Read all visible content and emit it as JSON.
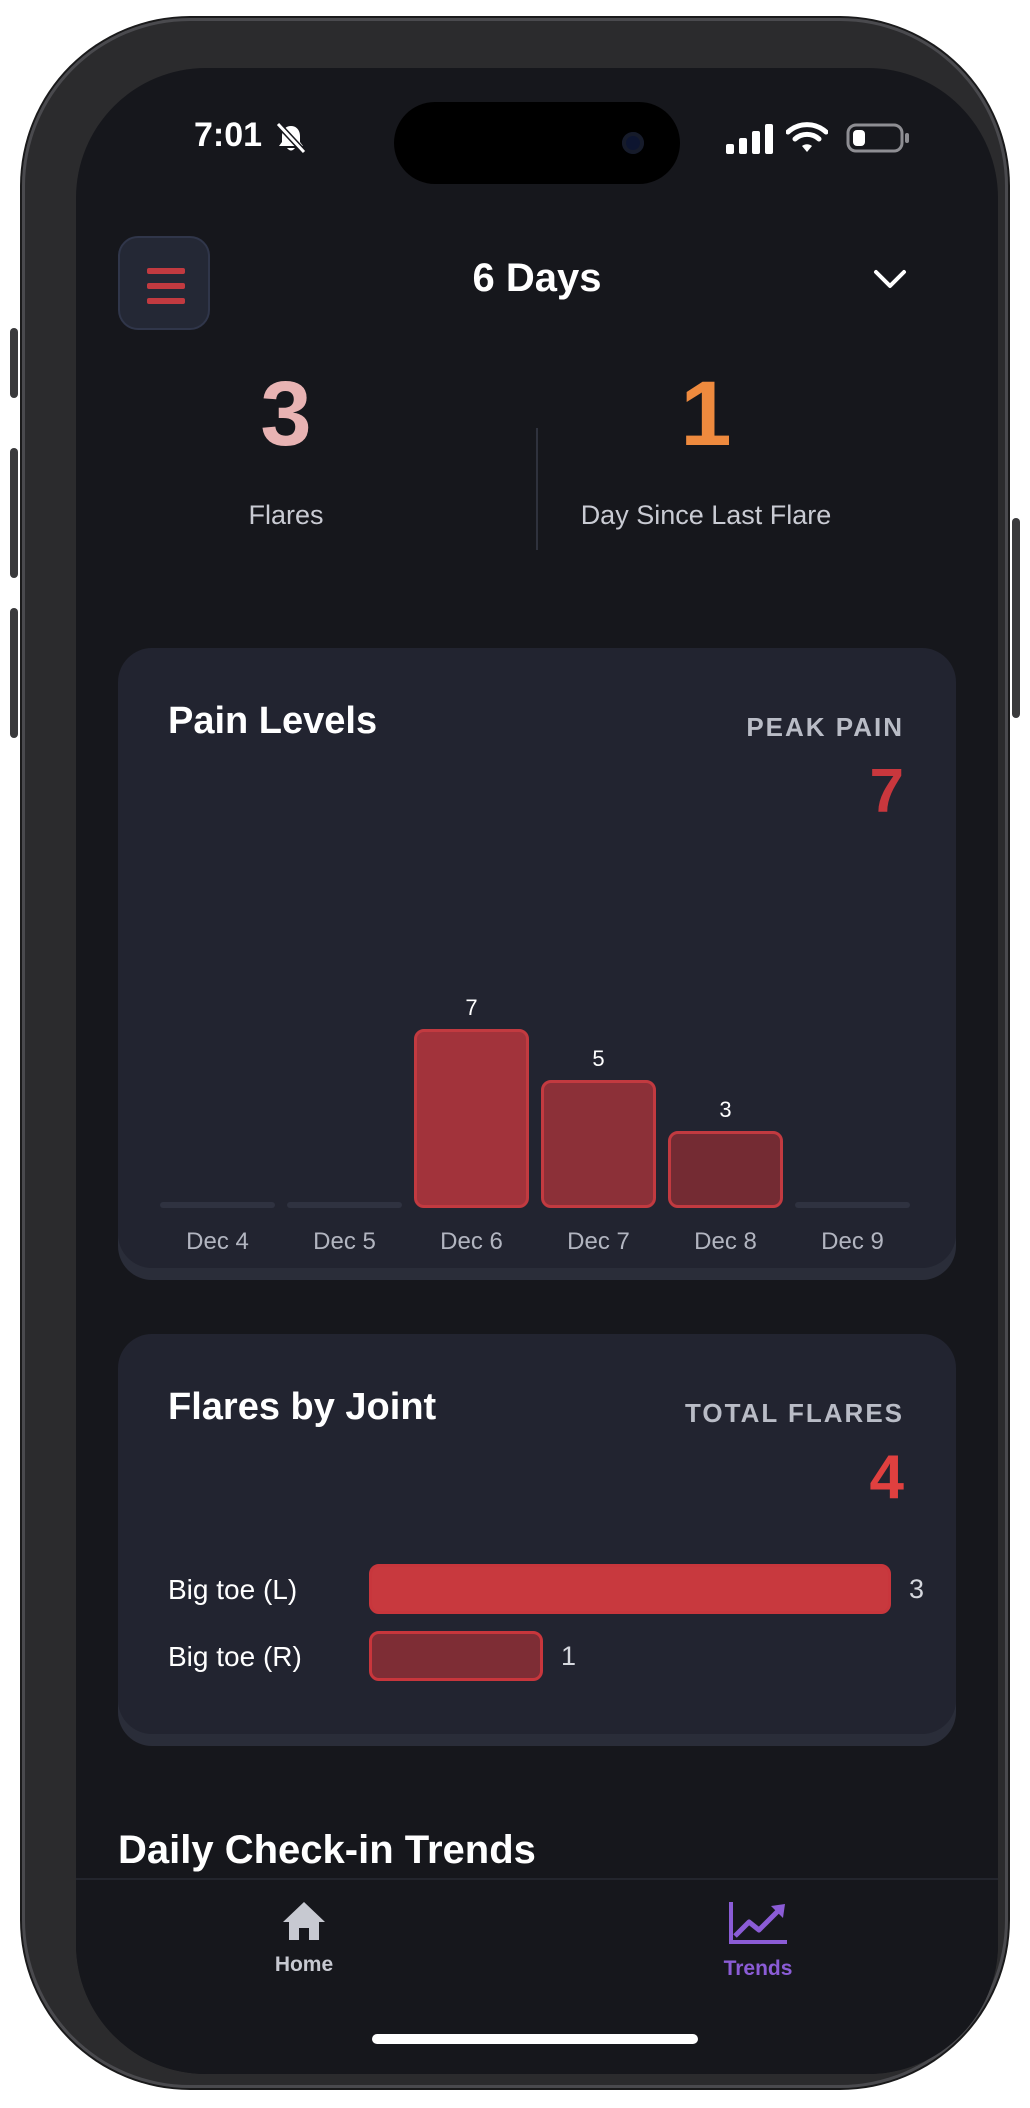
{
  "status_bar": {
    "time": "7:01"
  },
  "header": {
    "title": "6 Days"
  },
  "stats": [
    {
      "value": "3",
      "label": "Flares",
      "color": "#e8b3b3"
    },
    {
      "value": "1",
      "label": "Day Since Last Flare",
      "color": "#ee8a3e"
    }
  ],
  "pain_card": {
    "title": "Pain Levels",
    "stat_label": "PEAK PAIN",
    "stat_value": "7",
    "stat_color": "#c9373d"
  },
  "chart_data": {
    "type": "bar",
    "categories": [
      "Dec 4",
      "Dec 5",
      "Dec 6",
      "Dec 7",
      "Dec 8",
      "Dec 9"
    ],
    "values": [
      null,
      null,
      7,
      5,
      3,
      null
    ],
    "bar_colors": [
      "#8f2f37",
      "#8f2f37",
      "#a2333b",
      "#8c3038",
      "#742b33",
      "#8f2f37"
    ],
    "ylim": [
      0,
      10
    ],
    "title": "Pain Levels"
  },
  "joints_card": {
    "title": "Flares by Joint",
    "stat_label": "TOTAL FLARES",
    "stat_value": "4",
    "stat_color": "#e0403f",
    "joints": [
      {
        "label": "Big toe (L)",
        "count": 3,
        "color": "#c8393e"
      },
      {
        "label": "Big toe (R)",
        "count": 1,
        "color": "#7e2d35"
      }
    ]
  },
  "section_title": "Daily Check-in Trends",
  "tabs": [
    {
      "label": "Home",
      "icon": "home-icon",
      "active": false,
      "color": "#c7c9d1"
    },
    {
      "label": "Trends",
      "icon": "trends-icon",
      "active": true,
      "color": "#8b5cd6"
    }
  ]
}
